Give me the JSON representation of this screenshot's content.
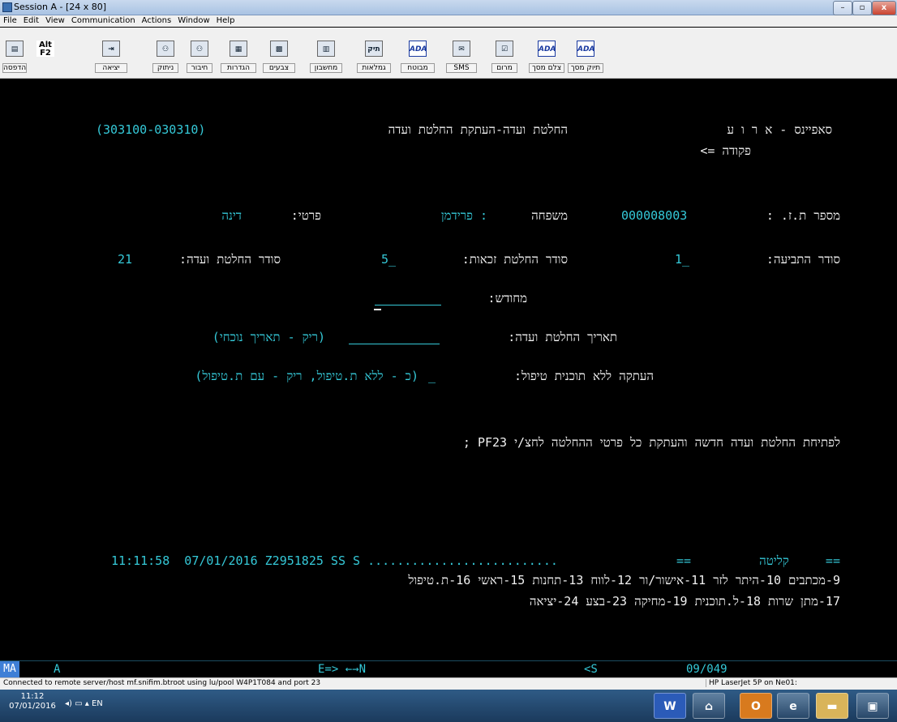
{
  "window": {
    "title": "Session A - [24 x 80]",
    "min": "–",
    "max": "▫",
    "close": "x"
  },
  "menu": [
    "File",
    "Edit",
    "View",
    "Communication",
    "Actions",
    "Window",
    "Help"
  ],
  "toolbar": [
    {
      "label": "הדפסה",
      "icon": "printer-icon",
      "glyph": "▤"
    },
    {
      "label": "",
      "icon": "alt-f2-icon",
      "glyph": "Alt F2"
    },
    {
      "label": "יציאה",
      "icon": "exit-icon",
      "glyph": "⇥"
    },
    {
      "label": "ניתוק",
      "icon": "disconnect-icon",
      "glyph": "⚇"
    },
    {
      "label": "חיבור",
      "icon": "connect-icon",
      "glyph": "⚇"
    },
    {
      "label": "הגדרות",
      "icon": "settings-icon",
      "glyph": "▦"
    },
    {
      "label": "צבעים",
      "icon": "colors-icon",
      "glyph": "▩"
    },
    {
      "label": "מחשבון",
      "icon": "calculator-icon",
      "glyph": "▥"
    },
    {
      "label": "גמלאות",
      "icon": "pensions-folder-icon",
      "glyph": "תיק"
    },
    {
      "label": "מבוטח",
      "icon": "ada-insured-icon",
      "glyph": "ADA"
    },
    {
      "label": "SMS",
      "icon": "sms-icon",
      "glyph": "✉"
    },
    {
      "label": "מרום",
      "icon": "marom-icon",
      "glyph": "☑"
    },
    {
      "label": "צלם מסך",
      "icon": "ada-screenshot-icon",
      "glyph": "ADA"
    },
    {
      "label": "תיוק מסך",
      "icon": "ada-file-screen-icon",
      "glyph": "ADA"
    }
  ],
  "terminal": {
    "system": "סאפיינס - א ר ו ע",
    "screen_title": "החלטת ועדה-העתקת החלטת ועדה",
    "screen_code": "(303100-030310)",
    "command": "פקודה =>",
    "id_label": "מספר ת.ז. :",
    "id_value": "000008003",
    "family_label": "משפחה",
    "family_value": ": פרידמן",
    "first_label": "פרטי:",
    "first_value": "דינה",
    "claim_label": "סודר התביעה:",
    "claim_value": "1_",
    "entitle_label": "סודר החלטת זכאות:",
    "entitle_value": "5_",
    "committee_label": "סודר החלטת ועדה:",
    "committee_value": "21",
    "renewed_label": "מחודש:",
    "date_label": "תאריך החלטת ועדה:",
    "date_hint": "(ריק - תאריך נוכחי)",
    "copy_label": "העתקה ללא תוכנית טיפול:",
    "copy_value": "_",
    "copy_hint": "(כ - ללא ת.טיפול, ריק - עם ת.טיפול)",
    "pf23_msg": "לפתיחת החלטת ועדה חדשה והעתקת כל פרטי ההחלטה לחצ/י PF23 ;",
    "status_mode": "==     קליטה",
    "status_end": "==",
    "status_dots": "11:11:58  07/01/2016 Z2951825 SS S ..........................",
    "keys1": "9-מכתבים 10-היתר לזר 11-אישור/ור 12-לווח 13-תחנות 15-ראשי 16-ת.טיפול",
    "keys2": "17-מתן שרות 18-ל.תוכנית 19-מחיקה 23-בצע 24-יציאה"
  },
  "oia": {
    "ma": "MA",
    "a": "A",
    "mid": "E=> ←→N",
    "s": "<S",
    "pos": "09/049"
  },
  "statusbar": {
    "conn": "Connected to remote server/host mf.snifim.btroot using lu/pool W4P1T084 and port 23",
    "printer": "HP LaserJet 5P on Ne01:"
  },
  "taskbar": {
    "time": "11:12",
    "date": "07/01/2016",
    "lang": "EN"
  }
}
